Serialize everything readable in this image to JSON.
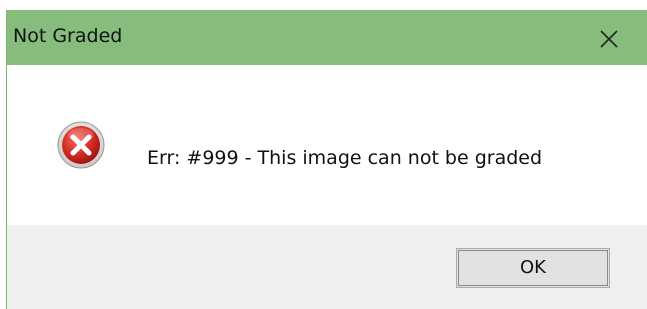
{
  "window": {
    "title": "Not Graded",
    "titlebar_color": "#86bd7c"
  },
  "icons": {
    "close": "close-icon",
    "error": "error-icon"
  },
  "dialog": {
    "message": "Err: #999 - This image can not be graded",
    "ok_label": "OK"
  }
}
